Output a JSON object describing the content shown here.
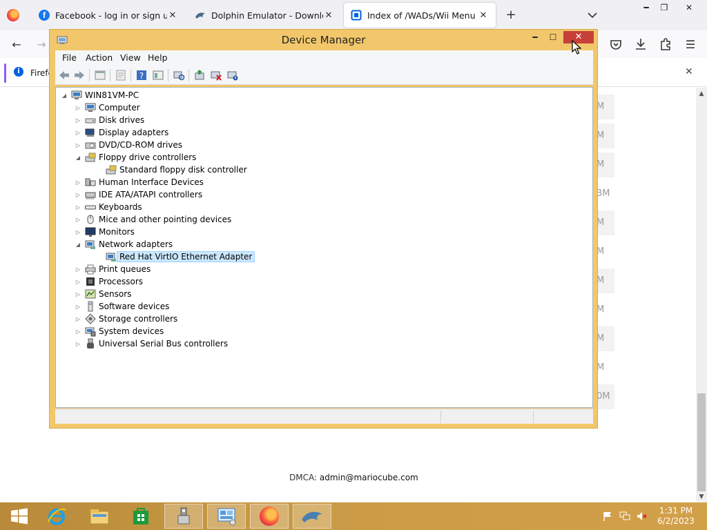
{
  "browser": {
    "tabs": [
      {
        "label": "Facebook - log in or sign up",
        "icon": "facebook-icon"
      },
      {
        "label": "Dolphin Emulator - Download",
        "icon": "dolphin-icon"
      },
      {
        "label": "Index of /WADs/Wii Menu",
        "icon": "page-icon"
      }
    ],
    "notification_text": "Firefo",
    "page_peeks": [
      "M",
      "M",
      "M",
      "3M",
      "M",
      "M",
      "M",
      "M",
      "M",
      "M",
      "0M"
    ],
    "dmca_label": "DMCA:",
    "dmca_email": "admin@mariocube.com"
  },
  "device_manager": {
    "title": "Device Manager",
    "menu": [
      "File",
      "Action",
      "View",
      "Help"
    ],
    "tree_root": "WIN81VM-PC",
    "tree": [
      {
        "label": "Computer",
        "icon": "computer-icon",
        "expanded": false
      },
      {
        "label": "Disk drives",
        "icon": "disk-drive-icon",
        "expanded": false
      },
      {
        "label": "Display adapters",
        "icon": "display-adapter-icon",
        "expanded": false
      },
      {
        "label": "DVD/CD-ROM drives",
        "icon": "dvd-drive-icon",
        "expanded": false
      },
      {
        "label": "Floppy drive controllers",
        "icon": "floppy-controller-icon",
        "expanded": true
      },
      {
        "label": "Standard floppy disk controller",
        "icon": "floppy-controller-icon",
        "child": true
      },
      {
        "label": "Human Interface Devices",
        "icon": "hid-icon",
        "expanded": false
      },
      {
        "label": "IDE ATA/ATAPI controllers",
        "icon": "ide-controller-icon",
        "expanded": false
      },
      {
        "label": "Keyboards",
        "icon": "keyboard-icon",
        "expanded": false
      },
      {
        "label": "Mice and other pointing devices",
        "icon": "mouse-icon",
        "expanded": false
      },
      {
        "label": "Monitors",
        "icon": "monitor-icon",
        "expanded": false
      },
      {
        "label": "Network adapters",
        "icon": "network-adapter-icon",
        "expanded": true
      },
      {
        "label": "Red Hat VirtIO Ethernet Adapter",
        "icon": "network-adapter-icon",
        "child": true,
        "selected": true
      },
      {
        "label": "Print queues",
        "icon": "printer-icon",
        "expanded": false
      },
      {
        "label": "Processors",
        "icon": "processor-icon",
        "expanded": false
      },
      {
        "label": "Sensors",
        "icon": "sensor-icon",
        "expanded": false
      },
      {
        "label": "Software devices",
        "icon": "software-device-icon",
        "expanded": false
      },
      {
        "label": "Storage controllers",
        "icon": "storage-controller-icon",
        "expanded": false
      },
      {
        "label": "System devices",
        "icon": "system-device-icon",
        "expanded": false
      },
      {
        "label": "Universal Serial Bus controllers",
        "icon": "usb-icon",
        "expanded": false
      }
    ]
  },
  "taskbar": {
    "apps": [
      "start-icon",
      "internet-explorer-icon",
      "file-explorer-icon",
      "store-icon",
      "device-manager-icon",
      "control-panel-icon",
      "firefox-icon",
      "dolphin-icon"
    ],
    "time": "1:31 PM",
    "date": "6/2/2023"
  },
  "colors": {
    "window_frame": "#f2c76b",
    "close_button": "#c7403a",
    "selection": "#cce8ff",
    "taskbar": "#c99a45"
  }
}
